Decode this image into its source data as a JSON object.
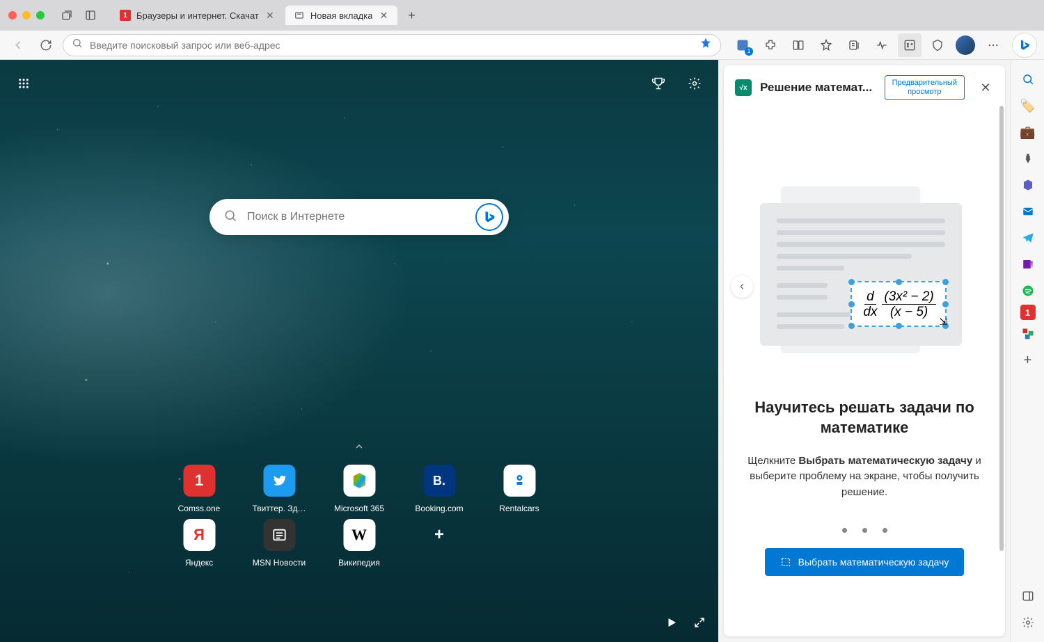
{
  "tabs": [
    {
      "title": "Браузеры и интернет. Скачат",
      "favicon_bg": "#e03131",
      "favicon_text": "1",
      "favicon_color": "#fff"
    },
    {
      "title": "Новая вкладка",
      "favicon_bg": "#ddd",
      "favicon_text": "⬚",
      "favicon_color": "#555"
    }
  ],
  "omnibox": {
    "placeholder": "Введите поисковый запрос или веб-адрес"
  },
  "toolbar_badge": "1",
  "ntp": {
    "search_placeholder": "Поиск в Интернете",
    "tiles": [
      {
        "label": "Comss.one",
        "bg": "#e03131",
        "fg": "#fff",
        "glyph": "1"
      },
      {
        "label": "Твиттер. Зд…",
        "bg": "#1d9bf0",
        "fg": "#fff",
        "glyph": "🐦"
      },
      {
        "label": "Microsoft 365",
        "bg": "#fff",
        "fg": "#333",
        "glyph": "⬢"
      },
      {
        "label": "Booking.com",
        "bg": "#003580",
        "fg": "#fff",
        "glyph": "B."
      },
      {
        "label": "Rentalcars",
        "bg": "#fff",
        "fg": "#0a7ad4",
        "glyph": "⦿"
      },
      {
        "label": "Яндекс",
        "bg": "#fff",
        "fg": "#e03131",
        "glyph": "Я"
      },
      {
        "label": "MSN Новости",
        "bg": "#333",
        "fg": "#fff",
        "glyph": "📰"
      },
      {
        "label": "Википедия",
        "bg": "#fff",
        "fg": "#000",
        "glyph": "W"
      }
    ]
  },
  "panel": {
    "title": "Решение математ...",
    "badge_line1": "Предварительный",
    "badge_line2": "просмотр",
    "heading": "Научитесь решать задачи по математике",
    "desc_pre": "Щелкните ",
    "desc_bold": "Выбрать математическую задачу",
    "desc_post": " и выберите проблему на экране, чтобы получить решение.",
    "math_expr": {
      "d": "d",
      "dx": "dx",
      "num": "(3x² − 2)",
      "den": "(x − 5)"
    },
    "cta": "Выбрать математическую задачу"
  },
  "sidebar_icons": [
    {
      "name": "search",
      "glyph": "🔍",
      "color": "#0078d4"
    },
    {
      "name": "shopping",
      "glyph": "🏷️",
      "color": "#0078d4"
    },
    {
      "name": "tools",
      "glyph": "💼",
      "color": "#a55a2a"
    },
    {
      "name": "games",
      "glyph": "♟️",
      "color": "#555"
    },
    {
      "name": "office",
      "glyph": "⬢",
      "color": "#d83b01"
    },
    {
      "name": "outlook",
      "glyph": "✉",
      "color": "#0078d4"
    },
    {
      "name": "telegram",
      "glyph": "✈",
      "color": "#2aabee"
    },
    {
      "name": "onenote",
      "glyph": "▥",
      "color": "#7719aa"
    },
    {
      "name": "spotify",
      "glyph": "●",
      "color": "#1db954"
    },
    {
      "name": "comss",
      "glyph": "1",
      "color": "#e03131"
    },
    {
      "name": "pcs",
      "glyph": "▦",
      "color": "#c0392b"
    },
    {
      "name": "add",
      "glyph": "+",
      "color": "#555"
    }
  ]
}
